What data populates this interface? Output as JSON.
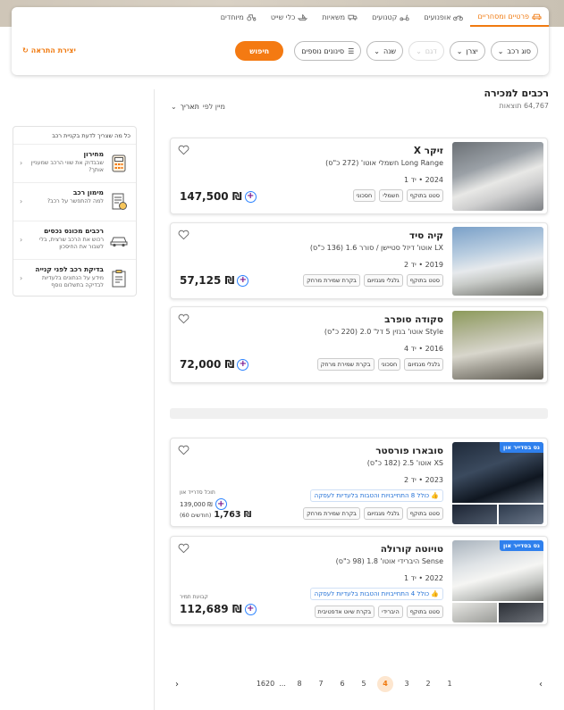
{
  "tabs": [
    {
      "label": "פרטיים ומסחריים",
      "active": true
    },
    {
      "label": "אופנועים",
      "active": false
    },
    {
      "label": "קטנועים",
      "active": false
    },
    {
      "label": "משאיות",
      "active": false
    },
    {
      "label": "כלי שייט",
      "active": false
    },
    {
      "label": "מיוחדים",
      "active": false
    }
  ],
  "filters": {
    "car_type": "סוג רכב",
    "manufacturer": "יצרן",
    "model": "דגם",
    "year": "שנה",
    "more_filters": "סינונים נוספים",
    "search": "חיפוש",
    "create_alert": "יצירת התראה"
  },
  "results": {
    "title": "רכבים למכירה",
    "count": "64,767 תוצאות",
    "sort_prefix": "מיין לפי",
    "sort_value": "תאריך"
  },
  "sidebar": {
    "header": "כל מה שצריך לדעת בקניית רכב",
    "items": [
      {
        "title": "מחירון",
        "desc": "שבבדוק את שווי הרכב שמעניין אותך?"
      },
      {
        "title": "מימון רכב",
        "desc": "למה להתפשר על רכב?"
      },
      {
        "title": "רכבים מכונס נכסים",
        "desc": "רכוש את הרכב שרצית, בלי לשבור את החיסכון"
      },
      {
        "title": "בדיקת רכב לפני קנייה",
        "desc": "מידע על הנתונים בלעדיות לבדיקה בתשלום נוסף"
      }
    ]
  },
  "cards": [
    {
      "name": "זיקר X",
      "sub": "Long Range חשמלי אוטו' (272 כ\"ס)",
      "year": "2024 • יד 1",
      "tags": [
        "סטט בתוקף",
        "חשמלי",
        "חסכוני"
      ],
      "price": "147,500 ₪"
    },
    {
      "name": "קיה סיד",
      "sub": "LX אוטו' דיזל סטיישן / סורר 1.6 (136 כ\"ס)",
      "year": "2019 • יד 2",
      "tags": [
        "סטט בתוקף",
        "גלגלי מגנזיום",
        "בקרת שמירת מרחק"
      ],
      "price": "57,125 ₪"
    },
    {
      "name": "סקודה סופרב",
      "sub": "Style אוטו' בנזין 5 דל' 2.0 (220 כ\"ס)",
      "year": "2016 • יד 4",
      "tags": [
        "גלגלי מגנזיום",
        "חסכוני",
        "בקרת שמירת מרחק"
      ],
      "price": "72,000 ₪"
    },
    {
      "name": "סובארו פורסטר",
      "sub": "XS אוטו' 2.5 (182 כ\"ס)",
      "year": "2023 • יד 2",
      "finance": "כולל 8 התחייבויות והטבות בלעדיות לעסקה",
      "tags": [
        "סטט בתוקף",
        "גלגלי מגנזיום",
        "בקרת שמירת מרחק"
      ],
      "badge": "נס בסדייר און",
      "price_note": "תוכל סדרייד און",
      "price_full": "139,000 ₪",
      "price": "1,763 ₪",
      "price_months": "(60 חודשים)"
    },
    {
      "name": "טויוטה קורולה",
      "sub": "Sense היברידי אוטו' 1.8 (98 כ\"ס)",
      "year": "2022 • יד 1",
      "finance": "כולל 4 התחייבויות והטבות בלעדיות לעסקה",
      "tags": [
        "סטט בתוקף",
        "היברידי",
        "בקרת שיוט אדפטיבית"
      ],
      "badge": "נס בסדייר און",
      "price_note": "קבועת תמיר",
      "price": "112,689 ₪"
    }
  ],
  "pagination": {
    "pages": [
      "1",
      "2",
      "3",
      "4",
      "5",
      "6",
      "7",
      "8",
      "...",
      "1620"
    ],
    "active": "4"
  },
  "colors": {
    "accent": "#f47a12",
    "finance": "#2f80ed",
    "plus": "#7b1c8e"
  }
}
